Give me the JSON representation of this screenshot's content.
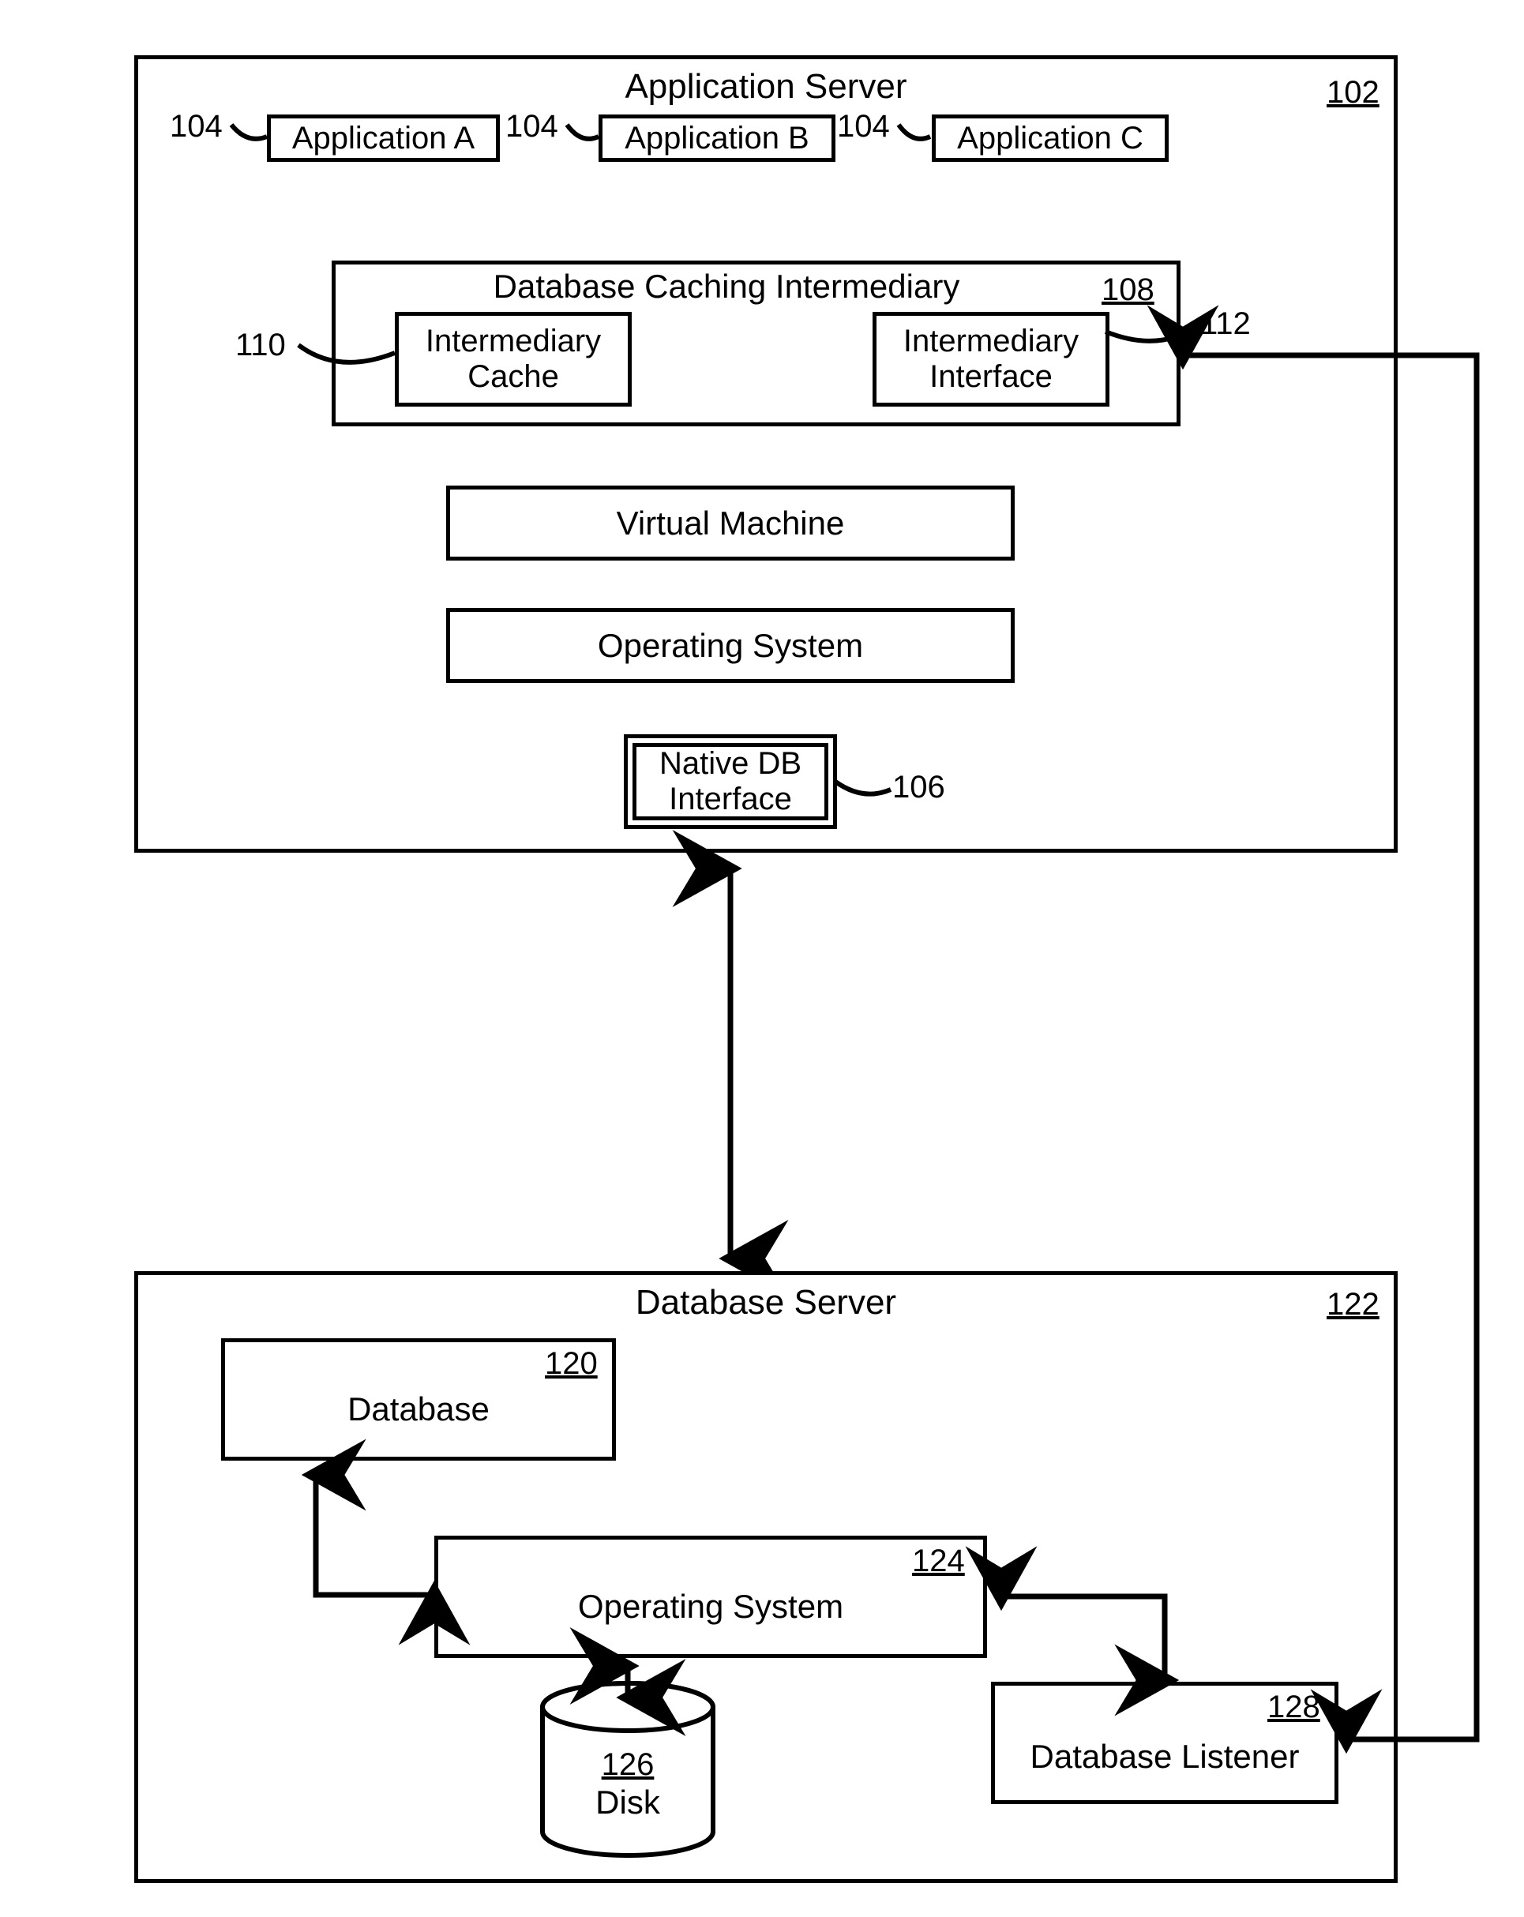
{
  "app_server": {
    "title": "Application Server",
    "num": "102",
    "apps": {
      "a": {
        "label": "Application A",
        "num": "104"
      },
      "b": {
        "label": "Application B",
        "num": "104"
      },
      "c": {
        "label": "Application C",
        "num": "104"
      }
    },
    "dci": {
      "title": "Database Caching Intermediary",
      "num": "108",
      "cache": {
        "label_line1": "Intermediary",
        "label_line2": "Cache",
        "num": "110"
      },
      "iface": {
        "label_line1": "Intermediary",
        "label_line2": "Interface",
        "num": "112"
      }
    },
    "vm": {
      "label": "Virtual Machine"
    },
    "os": {
      "label": "Operating System"
    },
    "native_db": {
      "label_line1": "Native DB",
      "label_line2": "Interface",
      "num": "106"
    }
  },
  "db_server": {
    "title": "Database Server",
    "num": "122",
    "database": {
      "label": "Database",
      "num": "120"
    },
    "os": {
      "label": "Operating System",
      "num": "124"
    },
    "listener": {
      "label": "Database Listener",
      "num": "128"
    },
    "disk": {
      "label": "Disk",
      "num": "126"
    }
  }
}
